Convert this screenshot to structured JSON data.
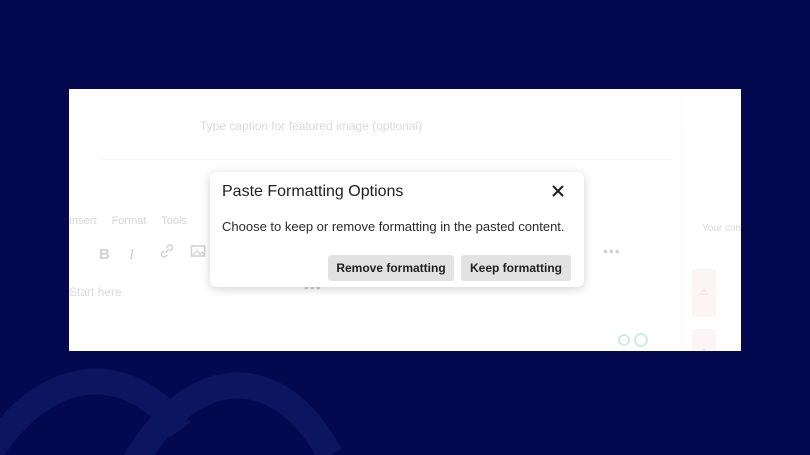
{
  "background_editor": {
    "caption_placeholder": "Type caption for featured image (optional)",
    "menu_items": [
      "Insert",
      "Format",
      "Tools"
    ],
    "toolbar_icons": [
      "bold-icon",
      "italic-icon",
      "link-icon",
      "image-icon"
    ],
    "bold_glyph": "B",
    "italic_glyph": "I",
    "more_glyph": "•••",
    "body_placeholder": "Start here",
    "side_panel_label": "Your con"
  },
  "dialog": {
    "title": "Paste Formatting Options",
    "close_glyph": "✕",
    "message": "Choose to keep or remove formatting in the pasted content.",
    "remove_button": "Remove formatting",
    "keep_button": "Keep formatting"
  },
  "colors": {
    "background": "#04084f",
    "dialog_bg": "#ffffff",
    "button_bg": "#e2e2e2"
  }
}
